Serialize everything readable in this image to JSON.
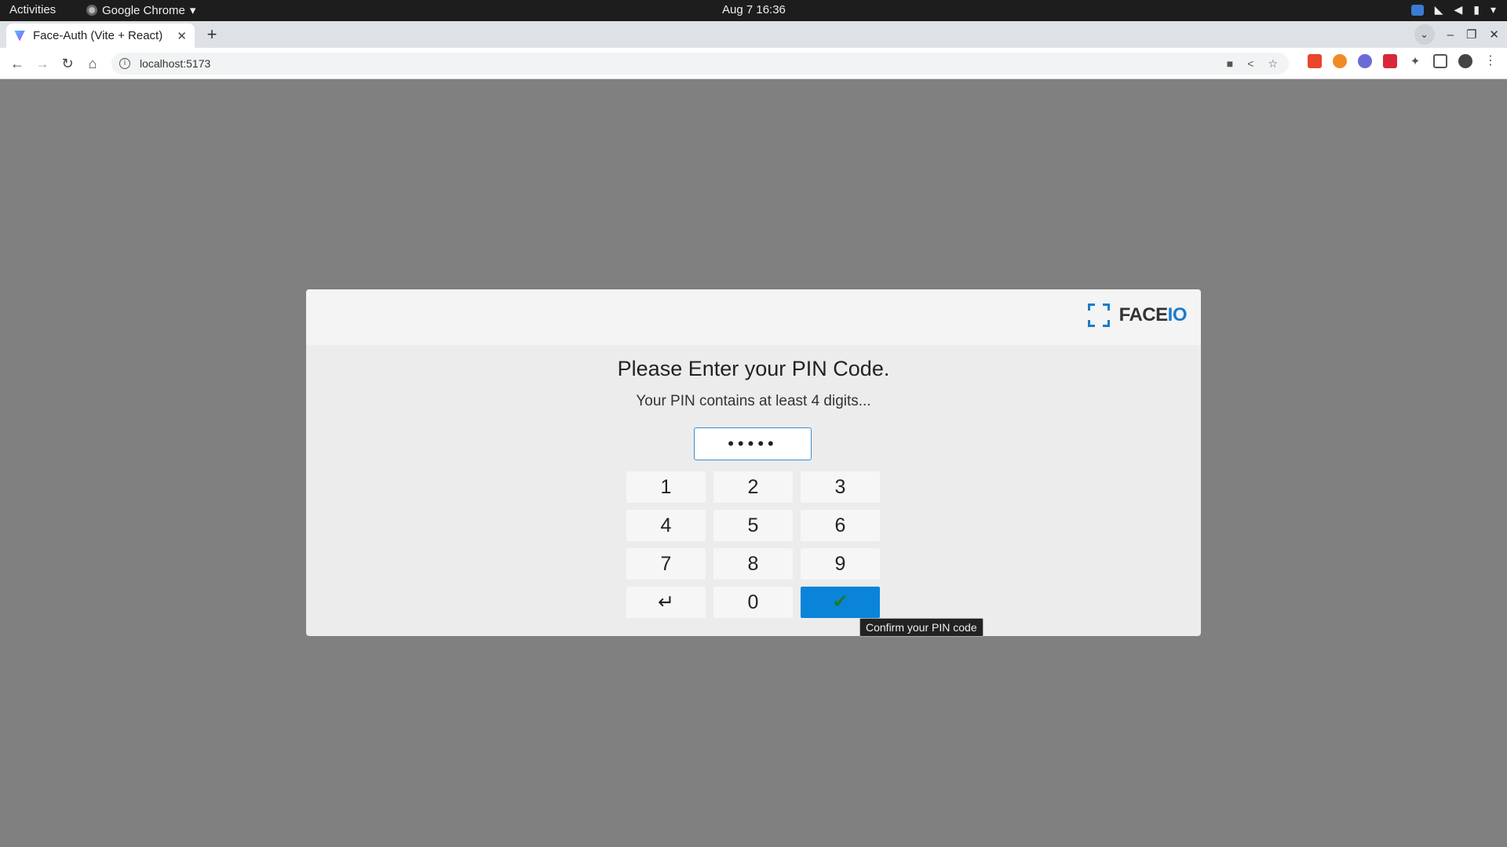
{
  "system": {
    "activities": "Activities",
    "app_menu": "Google Chrome",
    "clock": "Aug 7  16:36"
  },
  "browser": {
    "tab_title": "Face-Auth (Vite + React)",
    "url": "localhost:5173"
  },
  "modal": {
    "logo_face": "FACE",
    "logo_io": "IO",
    "title": "Please Enter your PIN Code.",
    "subtitle": "Your PIN contains at least 4 digits...",
    "pin_masked": "•••••",
    "keys": [
      "1",
      "2",
      "3",
      "4",
      "5",
      "6",
      "7",
      "8",
      "9",
      "↵",
      "0",
      "✔"
    ],
    "tooltip": "Confirm your PIN code",
    "accent_color": "#0a84d8"
  }
}
